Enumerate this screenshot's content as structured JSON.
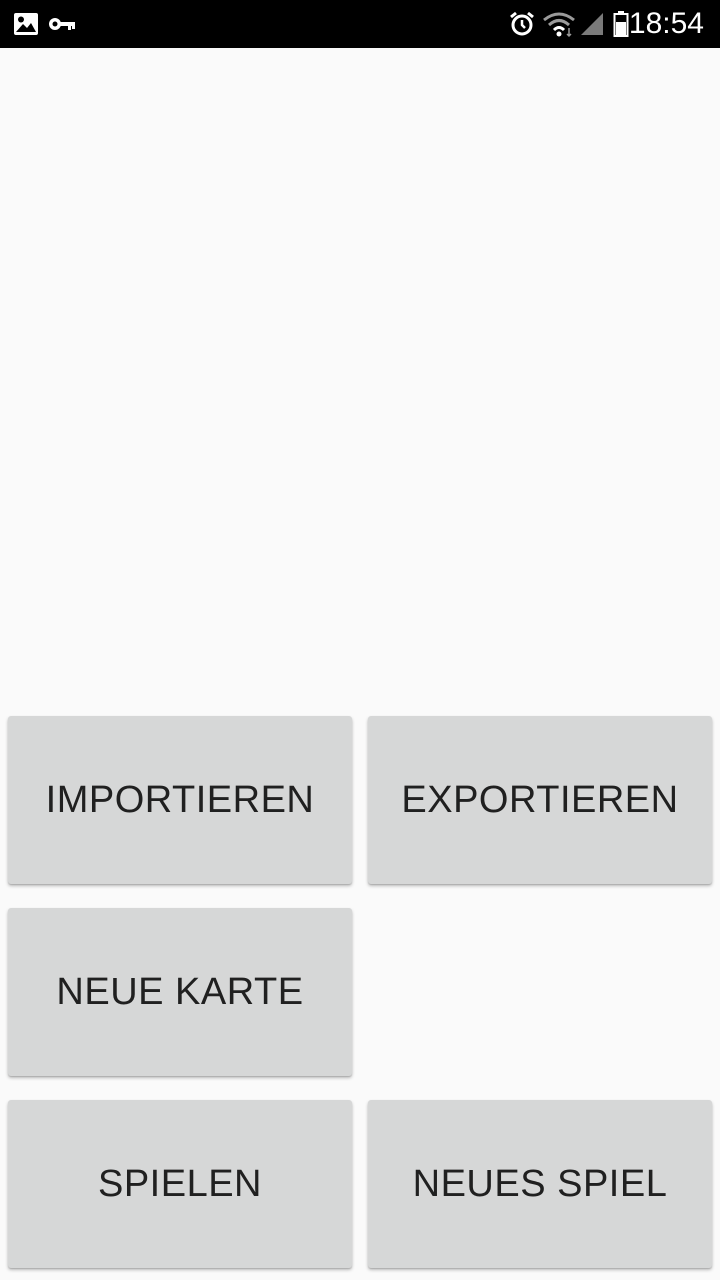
{
  "status_bar": {
    "time": "18:54",
    "left_icons": [
      "image-icon",
      "key-icon"
    ],
    "right_icons": [
      "alarm-icon",
      "wifi-icon",
      "signal-icon",
      "battery-icon"
    ]
  },
  "buttons": {
    "import_label": "IMPORTIEREN",
    "export_label": "EXPORTIEREN",
    "new_map_label": "NEUE KARTE",
    "play_label": "SPIELEN",
    "new_game_label": "NEUES SPIEL"
  },
  "colors": {
    "status_bar_bg": "#000000",
    "page_bg": "#fafafa",
    "button_bg": "#d6d7d7",
    "button_text": "#202020"
  }
}
